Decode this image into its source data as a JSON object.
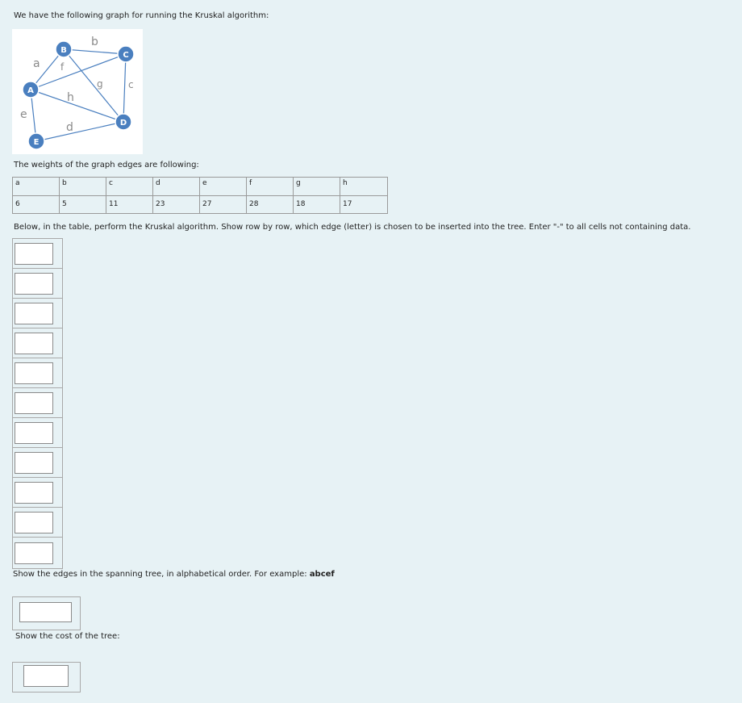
{
  "intro_text": "We have the following graph for running the Kruskal algorithm:",
  "graph": {
    "nodes": [
      "A",
      "B",
      "C",
      "D",
      "E"
    ],
    "edge_labels": [
      "a",
      "b",
      "c",
      "d",
      "e",
      "f",
      "g",
      "h"
    ],
    "node_color": "#4a7fbf",
    "label_color": "#8a8a8a"
  },
  "weights_text": "The weights of the graph edges are following:",
  "weights_table": {
    "headers": [
      "a",
      "b",
      "c",
      "d",
      "e",
      "f",
      "g",
      "h"
    ],
    "values": [
      "6",
      "5",
      "11",
      "23",
      "27",
      "28",
      "18",
      "17"
    ]
  },
  "instruction_text": "Below, in the table, perform the Kruskal algorithm. Show row by row, which edge (letter) is chosen to be inserted into the tree. Enter \"-\" to all cells not containing data.",
  "edges_prompt": "Show the edges in the spanning tree, in alphabetical order. For example: ",
  "edges_example": "abcef",
  "cost_prompt": "Show the cost of the tree:"
}
